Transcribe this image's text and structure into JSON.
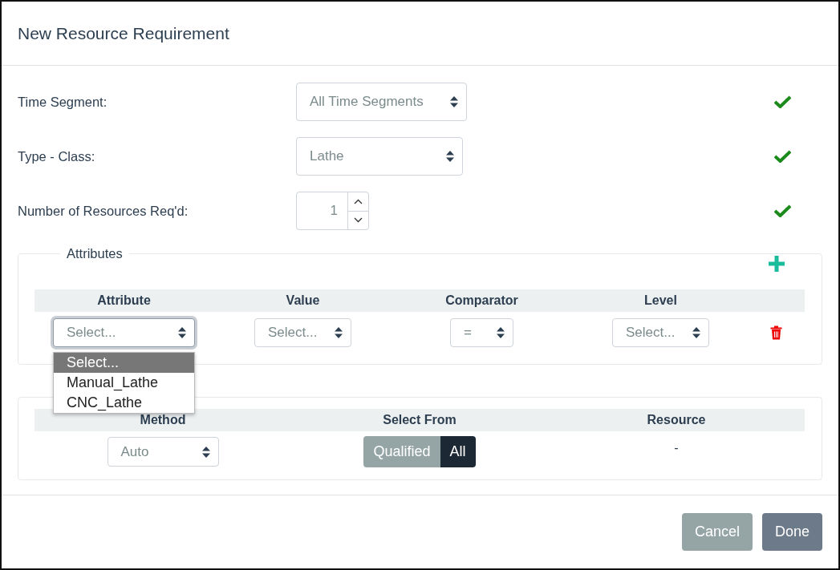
{
  "dialog": {
    "title": "New Resource Requirement"
  },
  "fields": [
    {
      "label": "Time Segment:",
      "kind": "select",
      "value": "All Time Segments",
      "valid": true
    },
    {
      "label": "Type - Class:",
      "kind": "select",
      "value": "Lathe",
      "valid": true
    },
    {
      "label": "Number of Resources Req'd:",
      "kind": "number",
      "value": "1",
      "valid": true
    }
  ],
  "attributes": {
    "legend": "Attributes",
    "columns": [
      "Attribute",
      "Value",
      "Comparator",
      "Level"
    ],
    "rows": [
      {
        "attribute": "Select...",
        "attribute_open": true,
        "value": "Select...",
        "comparator": "=",
        "level": "Select..."
      }
    ],
    "dropdown_options": [
      {
        "label": "Select...",
        "selected": true
      },
      {
        "label": "Manual_Lathe",
        "selected": false
      },
      {
        "label": "CNC_Lathe",
        "selected": false
      }
    ]
  },
  "selection": {
    "columns": [
      "Method",
      "Select From",
      "Resource"
    ],
    "method": "Auto",
    "resource": "-",
    "select_from": [
      {
        "label": "Qualified",
        "selected": false
      },
      {
        "label": "All",
        "selected": true
      }
    ]
  },
  "buttons": [
    {
      "label": "Cancel",
      "kind": "secondary"
    },
    {
      "label": "Done",
      "kind": "primary"
    }
  ]
}
